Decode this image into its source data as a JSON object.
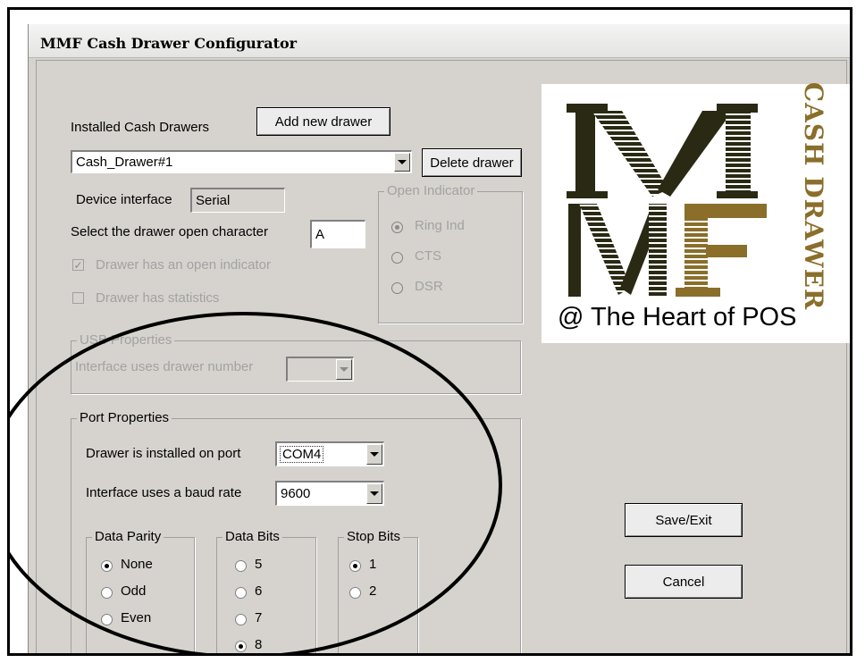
{
  "window": {
    "title": "MMF Cash Drawer Configurator"
  },
  "drawers": {
    "label": "Installed Cash Drawers",
    "add_button": "Add new drawer",
    "selected": "Cash_Drawer#1",
    "delete_button": "Delete drawer"
  },
  "device": {
    "interface_label": "Device interface",
    "interface_value": "Serial",
    "open_char_label": "Select the drawer open character",
    "open_char_value": "A",
    "open_indicator_check": "Drawer has an open indicator",
    "statistics_check": "Drawer has statistics"
  },
  "open_indicator": {
    "title": "Open Indicator",
    "options": [
      "Ring Ind",
      "CTS",
      "DSR"
    ],
    "selected": "Ring Ind"
  },
  "usb": {
    "title": "USB Properties",
    "drawer_number_label": "Interface uses drawer number"
  },
  "port": {
    "title": "Port Properties",
    "port_label": "Drawer is installed on port",
    "port_value": "COM4",
    "baud_label": "Interface uses a baud rate",
    "baud_value": "9600",
    "parity": {
      "title": "Data Parity",
      "options": [
        "None",
        "Odd",
        "Even"
      ],
      "selected": "None"
    },
    "data_bits": {
      "title": "Data Bits",
      "options": [
        "5",
        "6",
        "7",
        "8"
      ],
      "selected": "8"
    },
    "stop_bits": {
      "title": "Stop Bits",
      "options": [
        "1",
        "2"
      ],
      "selected": "1"
    }
  },
  "actions": {
    "save": "Save/Exit",
    "cancel": "Cancel"
  },
  "logo": {
    "letters_top": "M",
    "letters_bottom": "MF",
    "side_text": "CASH DRAWER",
    "tagline": "@ The Heart of POS",
    "colors": {
      "dark": "#2a2a14",
      "olive": "#8a6e2a",
      "stripe": "#ffffff"
    }
  },
  "annotation": {
    "shape": "ellipse",
    "color": "#000000"
  }
}
